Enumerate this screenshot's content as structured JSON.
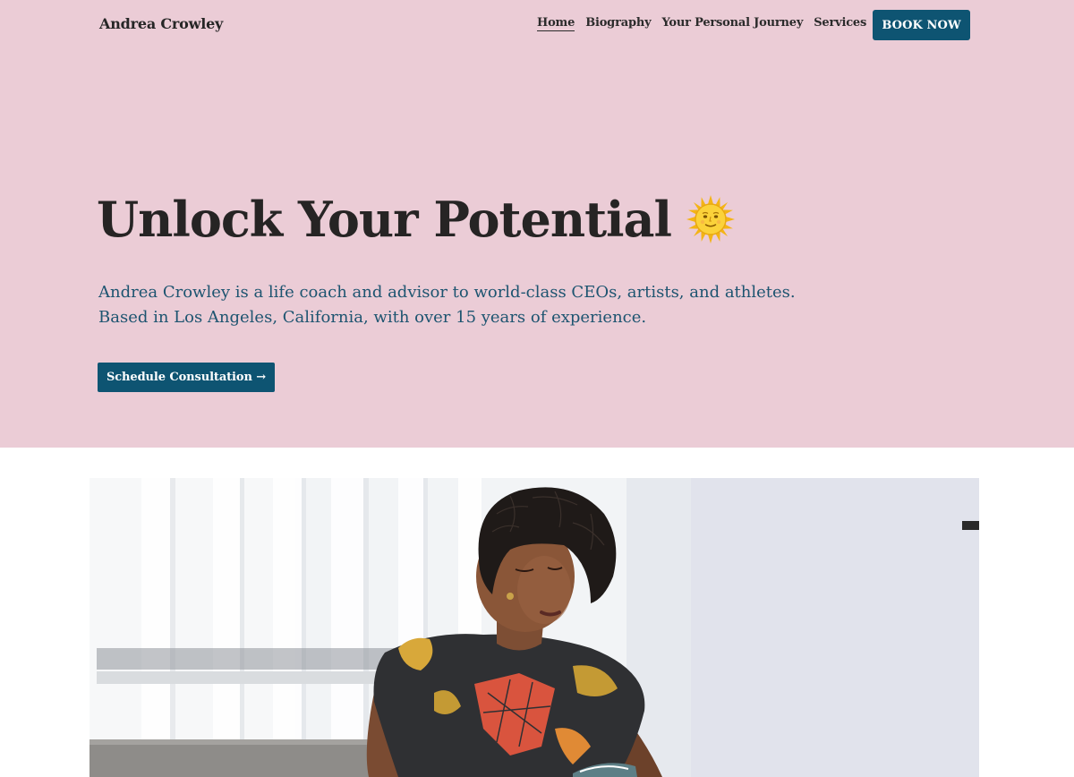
{
  "nav": {
    "brand": "Andrea Crowley",
    "links": [
      {
        "label": "Home",
        "active": true
      },
      {
        "label": "Biography"
      },
      {
        "label": "Your Personal Journey"
      },
      {
        "label": "Services"
      }
    ],
    "book_label": "BOOK NOW"
  },
  "hero": {
    "title": "Unlock Your Potential",
    "title_icon": "sun-with-face-icon",
    "description_lines": [
      "Andrea Crowley is a life coach and advisor to world-class CEOs, artists, and athletes.",
      "Based in Los Angeles, California, with over 15 years of experience."
    ],
    "cta_label": "Schedule Consultation →"
  },
  "colors": {
    "hero_background": "#ebccd6",
    "accent": "#0e5472",
    "text_dark": "#262424",
    "text_blue": "#1d5470"
  },
  "photo": {
    "icon": "woman-reading-photo"
  }
}
